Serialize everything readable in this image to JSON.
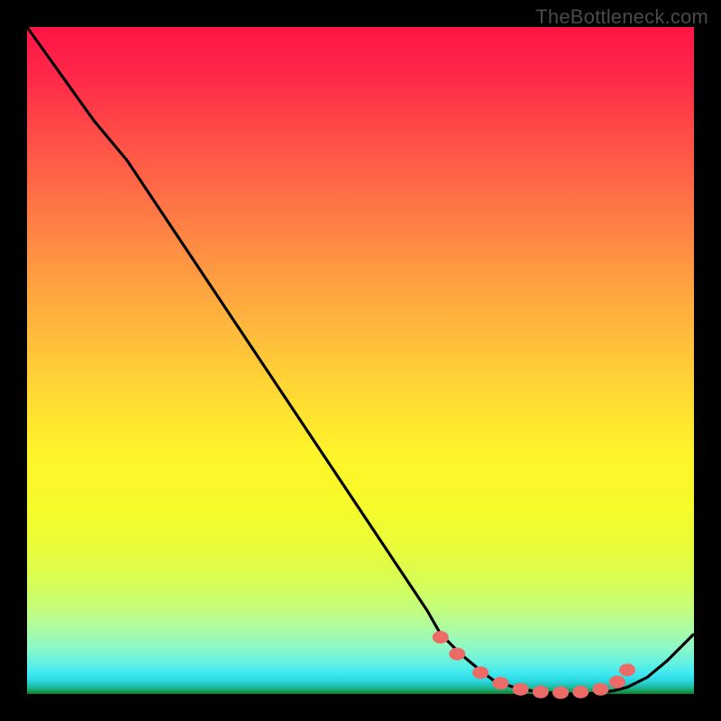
{
  "watermark": "TheBottleneck.com",
  "chart_data": {
    "type": "line",
    "title": "",
    "xlabel": "",
    "ylabel": "",
    "ylim": [
      0,
      100
    ],
    "xlim": [
      0,
      100
    ],
    "series": [
      {
        "name": "curve",
        "x": [
          0,
          5,
          10,
          15,
          20,
          25,
          30,
          35,
          40,
          45,
          50,
          55,
          60,
          62,
          65,
          68,
          70,
          73,
          76,
          80,
          84,
          86,
          88,
          90,
          93,
          96,
          100
        ],
        "y": [
          100,
          93,
          86,
          80,
          72.5,
          65,
          57.5,
          50,
          42.5,
          35,
          27.5,
          20,
          12.5,
          9,
          6,
          3.5,
          2,
          1,
          0.4,
          0,
          0,
          0.2,
          0.5,
          1,
          2.5,
          5,
          9
        ]
      }
    ],
    "markers": {
      "name": "dots",
      "x": [
        62,
        64.5,
        68,
        71,
        74,
        77,
        80,
        83,
        86,
        88.5,
        90
      ],
      "y": [
        8.5,
        6,
        3.2,
        1.6,
        0.7,
        0.3,
        0.2,
        0.3,
        0.7,
        1.8,
        3.6
      ]
    },
    "gradient_stops": [
      {
        "pos": 0,
        "color": "#ff1547"
      },
      {
        "pos": 50,
        "color": "#ffdd32"
      },
      {
        "pos": 85,
        "color": "#d8fd55"
      },
      {
        "pos": 100,
        "color": "#167d2e"
      }
    ]
  }
}
